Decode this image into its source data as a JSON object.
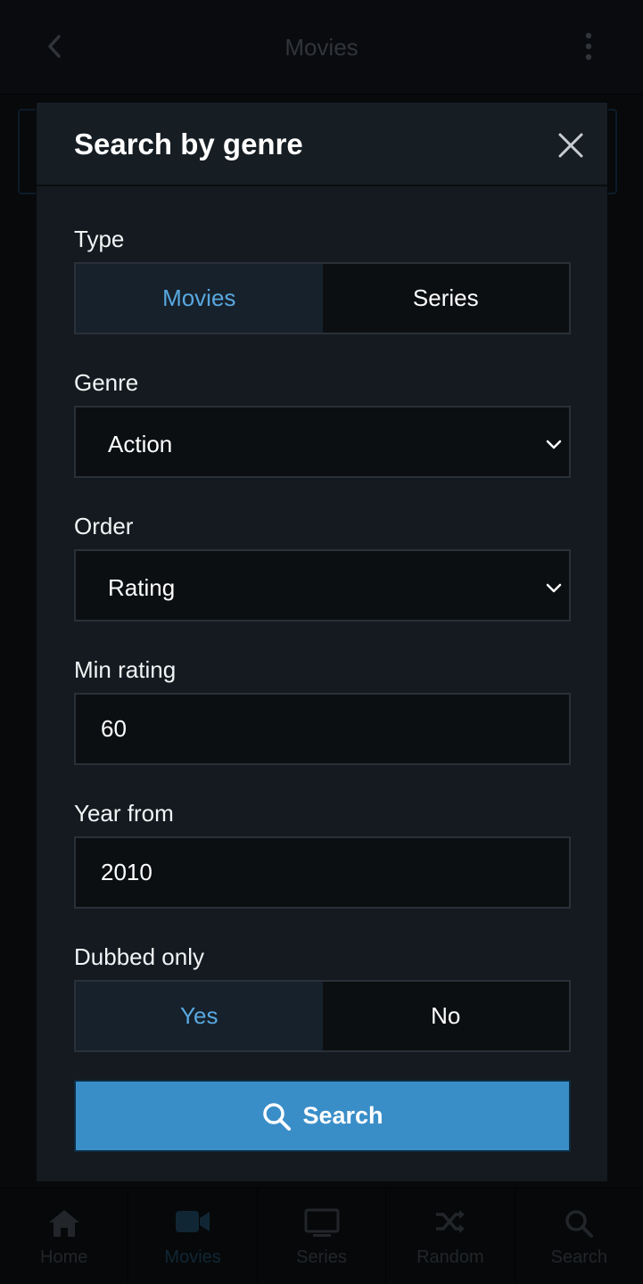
{
  "topbar": {
    "title": "Movies"
  },
  "bottom_nav": [
    {
      "label": "Home",
      "icon": "home-icon"
    },
    {
      "label": "Movies",
      "icon": "camera-icon",
      "active": true
    },
    {
      "label": "Series",
      "icon": "tv-icon"
    },
    {
      "label": "Random",
      "icon": "shuffle-icon"
    },
    {
      "label": "Search",
      "icon": "search-icon"
    }
  ],
  "modal": {
    "title": "Search by genre",
    "type": {
      "label": "Type",
      "options": [
        "Movies",
        "Series"
      ],
      "selected": "Movies"
    },
    "genre": {
      "label": "Genre",
      "value": "Action"
    },
    "order": {
      "label": "Order",
      "value": "Rating"
    },
    "min_rating": {
      "label": "Min rating",
      "value": "60"
    },
    "year_from": {
      "label": "Year from",
      "value": "2010"
    },
    "dubbed": {
      "label": "Dubbed only",
      "options": [
        "Yes",
        "No"
      ],
      "selected": "Yes"
    },
    "search_label": "Search"
  },
  "colors": {
    "accent": "#3a8ec8",
    "selected_text": "#58a8e0",
    "modal_bg": "#141a1f"
  }
}
